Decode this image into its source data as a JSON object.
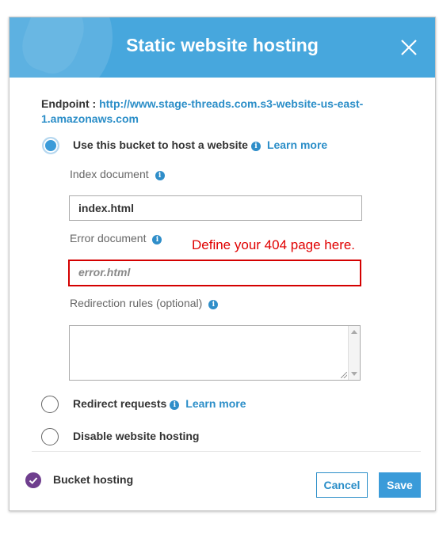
{
  "dialog": {
    "title": "Static website hosting"
  },
  "endpoint": {
    "label": "Endpoint :",
    "url": "http://www.stage-threads.com.s3-website-us-east-1.amazonaws.com"
  },
  "options": {
    "host": {
      "label": "Use this bucket to host a website",
      "learn_more": "Learn more",
      "selected": true
    },
    "redirect": {
      "label": "Redirect requests",
      "learn_more": "Learn more",
      "selected": false
    },
    "disable": {
      "label": "Disable website hosting",
      "selected": false
    }
  },
  "fields": {
    "index": {
      "label": "Index document",
      "value": "index.html"
    },
    "error": {
      "label": "Error document",
      "placeholder": "error.html",
      "value": ""
    },
    "rules": {
      "label": "Redirection rules (optional)",
      "value": ""
    }
  },
  "annotation": "Define your 404 page here.",
  "footer": {
    "status_label": "Bucket hosting",
    "cancel_label": "Cancel",
    "save_label": "Save"
  },
  "colors": {
    "header": "#47a7dd",
    "link": "#2b8ec8",
    "annotation": "#e00000",
    "check": "#6f3e8e"
  },
  "icons": [
    "close-icon",
    "info-icon",
    "check-circle-icon"
  ]
}
